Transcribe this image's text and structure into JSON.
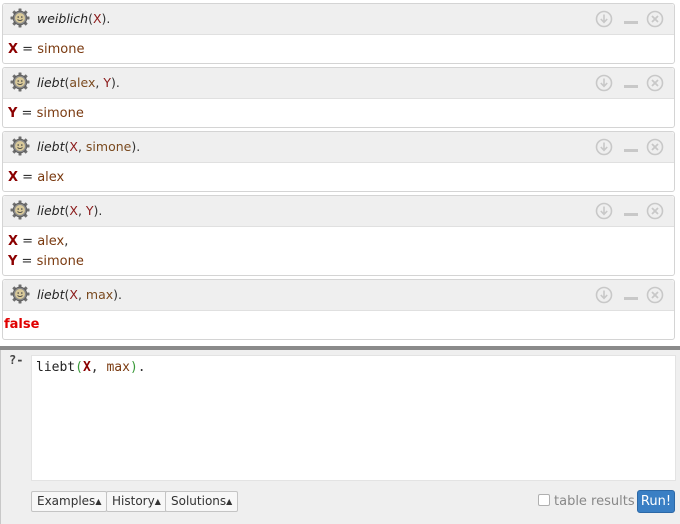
{
  "results": [
    {
      "query": {
        "pred": "weiblich",
        "open": "(",
        "parts": [
          {
            "t": "X",
            "k": "var"
          }
        ],
        "close": ")."
      },
      "answers": [
        {
          "var": "X",
          "eq": " = ",
          "val": "simone",
          "sep": ""
        }
      ]
    },
    {
      "query": {
        "pred": "liebt",
        "open": "(",
        "parts": [
          {
            "t": "alex",
            "k": "atom"
          },
          {
            "t": ", ",
            "k": "punc"
          },
          {
            "t": "Y",
            "k": "var"
          }
        ],
        "close": ")."
      },
      "answers": [
        {
          "var": "Y",
          "eq": " = ",
          "val": "simone",
          "sep": ""
        }
      ]
    },
    {
      "query": {
        "pred": "liebt",
        "open": "(",
        "parts": [
          {
            "t": "X",
            "k": "var"
          },
          {
            "t": ", ",
            "k": "punc"
          },
          {
            "t": "simone",
            "k": "atom"
          }
        ],
        "close": ")."
      },
      "answers": [
        {
          "var": "X",
          "eq": " = ",
          "val": "alex",
          "sep": ""
        }
      ]
    },
    {
      "query": {
        "pred": "liebt",
        "open": "(",
        "parts": [
          {
            "t": "X",
            "k": "var"
          },
          {
            "t": ", ",
            "k": "punc"
          },
          {
            "t": "Y",
            "k": "var"
          }
        ],
        "close": ")."
      },
      "answers": [
        {
          "var": "X",
          "eq": " = ",
          "val": "alex",
          "sep": ","
        },
        {
          "var": "Y",
          "eq": " = ",
          "val": "simone",
          "sep": ""
        }
      ]
    },
    {
      "query": {
        "pred": "liebt",
        "open": "(",
        "parts": [
          {
            "t": "X",
            "k": "var"
          },
          {
            "t": ", ",
            "k": "punc"
          },
          {
            "t": "max",
            "k": "atom"
          }
        ],
        "close": ")."
      },
      "false_text": "false"
    }
  ],
  "query_area": {
    "prompt": "?-",
    "editor": {
      "pred": "liebt",
      "open": "(",
      "var": "X",
      "comma": ", ",
      "atom": "max",
      "close": ")",
      "end": "."
    }
  },
  "toolbar": {
    "examples_label": "Examples",
    "history_label": "History",
    "solutions_label": "Solutions",
    "table_results_label": "table results",
    "table_results_checked": false,
    "run_label": "Run!"
  },
  "icons": {
    "query_status": "gear-icon",
    "download": "download-icon",
    "minimize": "minimize-icon",
    "close": "close-icon"
  },
  "colors": {
    "variable": "#8b0000",
    "atom": "#7a3a10",
    "false": "#e00000",
    "run_button": "#3a7fc4"
  }
}
